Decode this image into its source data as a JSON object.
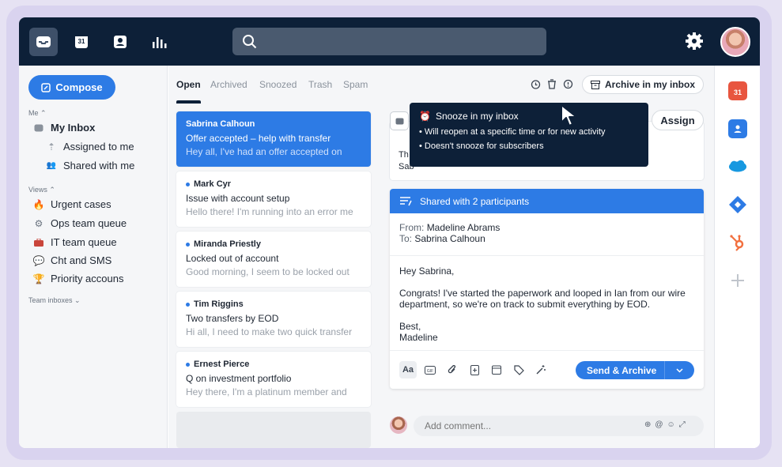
{
  "topbar": {
    "nav_icons": [
      "inbox-icon",
      "calendar-icon",
      "contacts-icon",
      "analytics-icon"
    ],
    "calendar_day": "31",
    "search_placeholder": "",
    "settings_icon": "gear-icon"
  },
  "sidebar": {
    "compose_label": "Compose",
    "me_label": "Me",
    "my_inbox": "My Inbox",
    "assigned_to_me": "Assigned to me",
    "shared_with_me": "Shared with me",
    "views_label": "Views",
    "views": [
      "Urgent cases",
      "Ops team queue",
      "IT team queue",
      "Cht and SMS",
      "Priority accouns"
    ],
    "team_inboxes_label": "Team inboxes"
  },
  "tabs": [
    "Open",
    "Archived",
    "Snoozed",
    "Trash",
    "Spam"
  ],
  "toolbar": {
    "archive_label": "Archive in my inbox",
    "assign_label": "Assign"
  },
  "tooltip": {
    "title": "Snooze in my inbox",
    "line1": "• Will reopen at a specific time or for new activity",
    "line2": "• Doesn't snooze for subscribers"
  },
  "conversations": [
    {
      "name": "Sabrina Calhoun",
      "subject": "Offer accepted – help with transfer",
      "preview": "Hey all, I've had an offer accepted on"
    },
    {
      "name": "Mark Cyr",
      "subject": "Issue with account setup",
      "preview": "Hello there! I'm running into an error me"
    },
    {
      "name": "Miranda Priestly",
      "subject": "Locked out of account",
      "preview": "Good morning, I seem to be locked out"
    },
    {
      "name": "Tim Riggins",
      "subject": "Two transfers by EOD",
      "preview": "Hi all, I need to make two quick transfer"
    },
    {
      "name": "Ernest Pierce",
      "subject": "Q on investment portfolio",
      "preview": "Hey there, I'm a platinum member and"
    }
  ],
  "top_message": {
    "line1": "Th",
    "line2": "Sab"
  },
  "shared": {
    "header": "Shared with 2 participants",
    "from_label": "From:",
    "from_name": "Madeline Abrams",
    "to_label": "To:",
    "to_name": "Sabrina Calhoun",
    "greeting": "Hey Sabrina,",
    "body": "Congrats! I've started the paperwork and looped in Ian from our wire department, so we're on track to submit everything by EOD.",
    "signoff": "Best,",
    "signature": "Madeline",
    "format_label": "Aa",
    "send_label": "Send & Archive"
  },
  "comment": {
    "placeholder": "Add comment..."
  },
  "rail": {
    "items": [
      "calendar-icon",
      "contacts-icon",
      "salesforce-icon",
      "jira-icon",
      "hubspot-icon",
      "add-icon"
    ],
    "calendar_day": "31",
    "colors": {
      "calendar": "#e8553f",
      "contacts": "#2d7be5",
      "salesforce": "#1798e0",
      "jira": "#2d7be5",
      "hubspot": "#f2703f"
    }
  },
  "colors": {
    "accent": "#2d7be5",
    "topbar": "#0d2038"
  }
}
